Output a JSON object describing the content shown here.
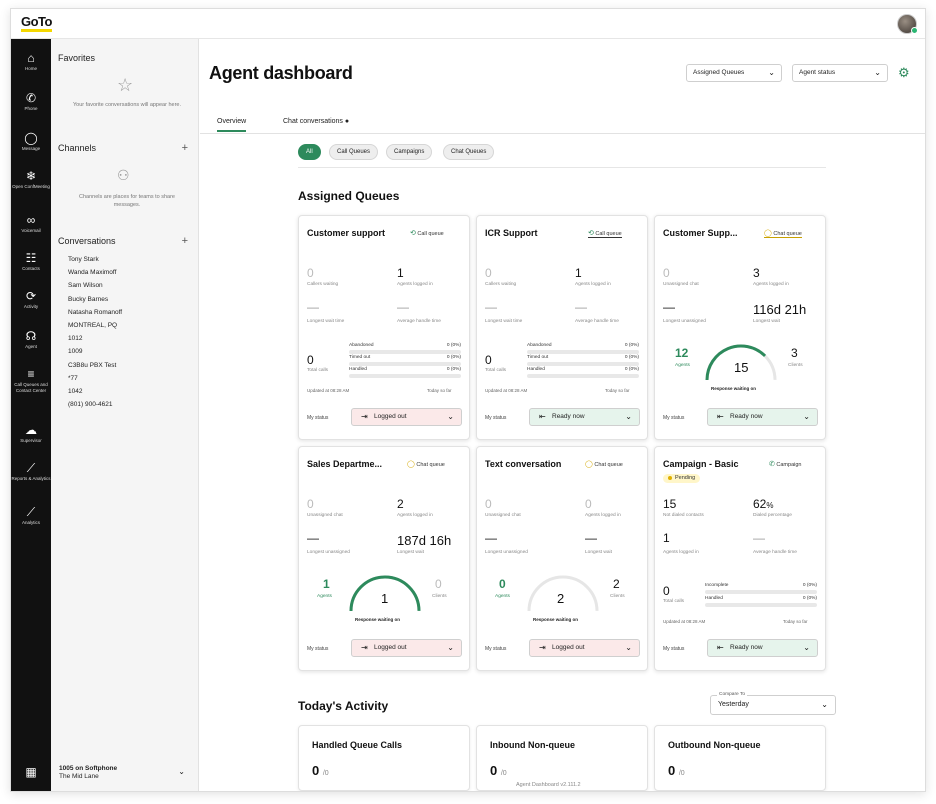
{
  "app": {
    "logo": "GoTo"
  },
  "rail": [
    {
      "icon": "home-icon",
      "glyph": "⌂",
      "label": "Home"
    },
    {
      "icon": "phone-icon",
      "glyph": "✆",
      "label": "Phone"
    },
    {
      "icon": "message-icon",
      "glyph": "◯",
      "label": "Message"
    },
    {
      "icon": "snowflake-icon",
      "glyph": "❄",
      "label": "Open ConfMeeting"
    },
    {
      "icon": "voicemail-icon",
      "glyph": "∞",
      "label": "Voicemail"
    },
    {
      "icon": "contacts-icon",
      "glyph": "☷",
      "label": "Contacts"
    },
    {
      "icon": "activity-icon",
      "glyph": "⟳",
      "label": "Activity"
    },
    {
      "icon": "agent-icon",
      "glyph": "☊",
      "label": "Agent"
    },
    {
      "icon": "queues-icon",
      "glyph": "≡",
      "label": "Call Queues and Contact Center"
    },
    {
      "icon": "supervisor-icon",
      "glyph": "☁",
      "label": "Supervisor"
    },
    {
      "icon": "reports-icon",
      "glyph": "⟋",
      "label": "Reports & Analytics"
    },
    {
      "icon": "analytics-icon",
      "glyph": "⟋",
      "label": "Analytics"
    }
  ],
  "sidebar": {
    "favorites_title": "Favorites",
    "favorites_hint": "Your favorite conversations will appear here.",
    "channels_title": "Channels",
    "channels_hint": "Channels are places for teams to share messages.",
    "conversations_title": "Conversations",
    "conversations": [
      "Tony Stark",
      "Wanda Maximoff",
      "Sam Wilson",
      "Bucky Barnes",
      "Natasha Romanoff",
      "MONTREAL, PQ",
      "1012",
      "1009",
      "C3B8u PBX Test",
      "*77",
      "1042",
      "(801) 900-4621"
    ],
    "footer_line1": "1005 on Softphone",
    "footer_line2": "The Mid Lane"
  },
  "header": {
    "title": "Agent dashboard",
    "assigned_queues": "Assigned Queues",
    "agent_status": "Agent status"
  },
  "tabs": [
    {
      "label": "Overview"
    },
    {
      "label": "Chat conversations ●"
    }
  ],
  "filters": [
    "All",
    "Call Queues",
    "Campaigns",
    "Chat Queues"
  ],
  "assigned_queues_title": "Assigned Queues",
  "cards": {
    "c1": {
      "title": "Customer support",
      "type": "Call queue",
      "s1v": "0",
      "s1l": "Callers waiting",
      "s2v": "1",
      "s2l": "Agents logged in",
      "s3v": "—",
      "s3l": "Longest wait time",
      "s4v": "—",
      "s4l": "Average handle time",
      "tv": "0",
      "tl": "Total calls",
      "b1": "Abandoned",
      "b1v": "0 (0%)",
      "b2": "Timed out",
      "b2v": "0 (0%)",
      "b3": "Handled",
      "b3v": "0 (0%)",
      "upd": "Updated at 08:28 AM",
      "sofar": "Today so far",
      "mystatus": "My status",
      "status": "Logged out"
    },
    "c2": {
      "title": "ICR Support",
      "type": "Call queue",
      "s1v": "0",
      "s1l": "Callers waiting",
      "s2v": "1",
      "s2l": "Agents logged in",
      "s3v": "—",
      "s3l": "Longest wait time",
      "s4v": "—",
      "s4l": "Average handle time",
      "tv": "0",
      "tl": "Total calls",
      "b1": "Abandoned",
      "b1v": "0 (0%)",
      "b2": "Timed out",
      "b2v": "0 (0%)",
      "b3": "Handled",
      "b3v": "0 (0%)",
      "upd": "Updated at 08:28 AM",
      "sofar": "Today so far",
      "mystatus": "My status",
      "status": "Ready now"
    },
    "c3": {
      "title": "Customer Supp...",
      "type": "Chat queue",
      "s1v": "0",
      "s1l": "Unassigned chat",
      "s2v": "3",
      "s2l": "Agents logged in",
      "s3v": "—",
      "s3l": "Longest unassigned",
      "s4v": "116d 21h",
      "s4l": "Longest wait",
      "agents": "12",
      "agents_l": "Agents",
      "center": "15",
      "clients": "3",
      "clients_l": "Clients",
      "resp": "Response waiting on",
      "mystatus": "My status",
      "status": "Ready now"
    },
    "c4": {
      "title": "Sales Departme...",
      "type": "Chat queue",
      "s1v": "0",
      "s1l": "Unassigned chat",
      "s2v": "2",
      "s2l": "Agents logged in",
      "s3v": "—",
      "s3l": "Longest unassigned",
      "s4v": "187d 16h",
      "s4l": "Longest wait",
      "agents": "1",
      "agents_l": "Agents",
      "center": "1",
      "clients": "0",
      "clients_l": "Clients",
      "resp": "Response waiting on",
      "mystatus": "My status",
      "status": "Logged out"
    },
    "c5": {
      "title": "Text conversation",
      "type": "Chat queue",
      "s1v": "0",
      "s1l": "Unassigned chat",
      "s2v": "0",
      "s2l": "Agents logged in",
      "s3v": "—",
      "s3l": "Longest unassigned",
      "s4v": "—",
      "s4l": "Longest wait",
      "agents": "0",
      "agents_l": "Agents",
      "center": "2",
      "clients": "2",
      "clients_l": "Clients",
      "resp": "Response waiting on",
      "mystatus": "My status",
      "status": "Logged out"
    },
    "c6": {
      "title": "Campaign - Basic",
      "type": "Campaign",
      "pending": "Pending",
      "s1v": "15",
      "s1l": "Not dialed contacts",
      "s2v": "62",
      "s2u": "%",
      "s2l": "Dialed percentage",
      "s3v": "1",
      "s3l": "Agents logged in",
      "s4v": "—",
      "s4l": "Average handle time",
      "tv": "0",
      "tl": "Total calls",
      "b1": "Incomplete",
      "b1v": "0 (0%)",
      "b2": "Handled",
      "b2v": "0 (0%)",
      "upd": "Updated at 08:28 AM",
      "sofar": "Today so far",
      "mystatus": "My status",
      "status": "Ready now"
    }
  },
  "gauges": {
    "c3": 0.75,
    "c4": 1.0,
    "c5": 0.0
  },
  "today": {
    "title": "Today's Activity",
    "compare_label": "Compare To",
    "compare_value": "Yesterday",
    "items": [
      {
        "title": "Handled Queue Calls",
        "value": "0",
        "of": "/0"
      },
      {
        "title": "Inbound Non-queue",
        "value": "0",
        "of": "/0"
      },
      {
        "title": "Outbound Non-queue",
        "value": "0",
        "of": "/0"
      }
    ]
  },
  "version": "Agent Dashboard v2.111.2",
  "colors": {
    "accent": "#2d8a5c",
    "logged_out_bg": "#fbe9e9",
    "ready_bg": "#e6f4ec",
    "brand_yellow": "#f5d800"
  }
}
